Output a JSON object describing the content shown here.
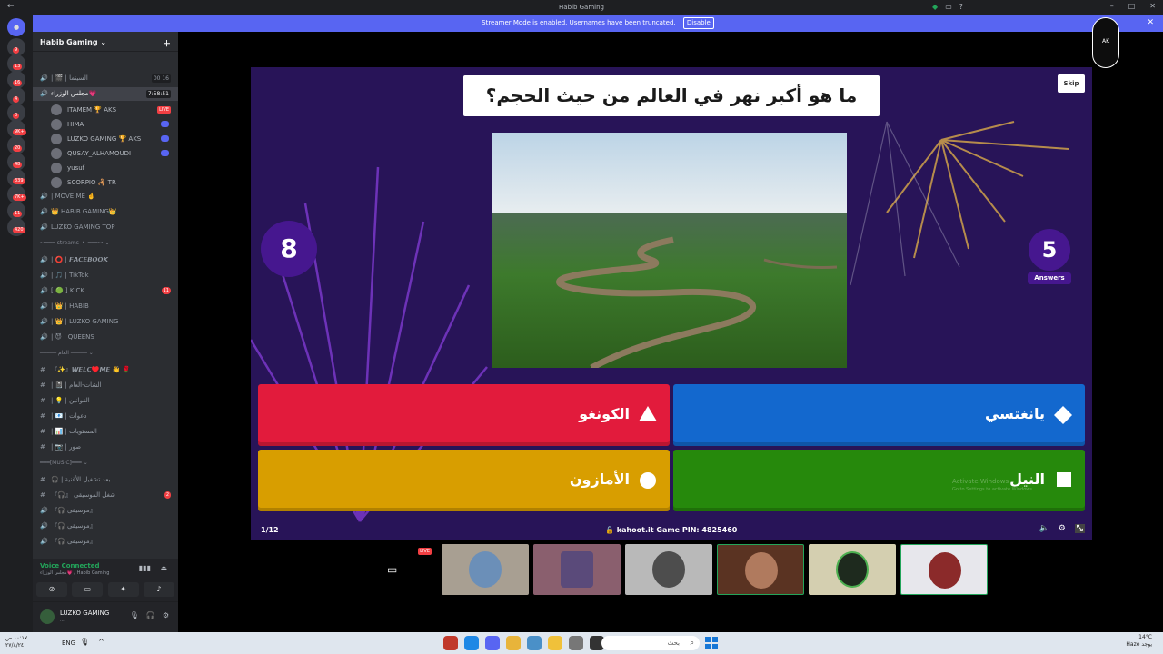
{
  "window": {
    "title": "Habib Gaming"
  },
  "banner": {
    "text": "Streamer Mode is enabled. Usernames have been truncated.",
    "button": "Disable"
  },
  "server": {
    "name": "Habib Gaming ⌄"
  },
  "rail_badges": [
    "9",
    "13",
    "16",
    "4",
    "3",
    "9K+",
    "20",
    "48",
    "339",
    "7K+",
    "11",
    "420"
  ],
  "channels": [
    {
      "icon": "🔊",
      "name": "| 🎬 | السينما",
      "count": "00 16"
    },
    {
      "icon": "🔊",
      "name": "مجلس الوزراء💗",
      "count": "7:58:51",
      "selected": true
    },
    {
      "icon": "🔊",
      "name": "| MOVE ME 🤞"
    },
    {
      "icon": "🔊",
      "name": "👑 HABIB GAMING👑"
    },
    {
      "icon": "🔊",
      "name": "LUZKO GAMING TOP"
    },
    {
      "cat": true,
      "name": "⊶━━━ streams ・ ━━━⊶ ⌄"
    },
    {
      "icon": "🔊",
      "name": "| ⭕ | 𝙁𝘼𝘾𝙀𝘽𝙊𝙊𝙆"
    },
    {
      "icon": "🔊",
      "name": "| 🎵 | TikTok"
    },
    {
      "icon": "🔊",
      "name": "[ 🟢 ] KICK",
      "badge": "11"
    },
    {
      "icon": "🔊",
      "name": "| 👑 | HABIB"
    },
    {
      "icon": "🔊",
      "name": "| 👑 | LUZKO GAMING"
    },
    {
      "icon": "🔊",
      "name": "| 😈 | QUEENS"
    },
    {
      "cat": true,
      "name": "━━━━━ العام ━━━━━ ⌄"
    },
    {
      "icon": "#",
      "name": "『✨』𝙒𝙀𝙇𝘾♥️𝙈𝙀 👋 🌹"
    },
    {
      "icon": "#",
      "name": "| 📓 | الشات-العام"
    },
    {
      "icon": "#",
      "name": "| 💡 | القوانين"
    },
    {
      "icon": "#",
      "name": "| 📧 | دعوات"
    },
    {
      "icon": "#",
      "name": "| 📊 | المستويات"
    },
    {
      "icon": "#",
      "name": "| 📷 | صور"
    },
    {
      "cat": true,
      "name": "━━━[MUSIC]━━━ ⌄"
    },
    {
      "icon": "#",
      "name": "🎧 | بعد تشغيل الأغنية"
    },
    {
      "icon": "#",
      "name": "『🎧』 شغل الموسيقى",
      "badge": "2"
    },
    {
      "icon": "🔊",
      "name": "『🎧 موسيقى』"
    },
    {
      "icon": "🔊",
      "name": "『🎧 موسيقى』"
    },
    {
      "icon": "🔊",
      "name": "『🎧 موسيقى』"
    }
  ],
  "voice_users": [
    {
      "name": "ITAMEM 🏆 AKS",
      "tag": "LIVE"
    },
    {
      "name": "HIMA",
      "tag": "game"
    },
    {
      "name": "LUZKO GAMING 🏆 AKS",
      "tag": "game"
    },
    {
      "name": "QUSAY_ALHAMOUDI",
      "tag": "game"
    },
    {
      "name": "yusuf",
      "tag": ""
    },
    {
      "name": "SCORPIO 🦂 TR",
      "tag": ""
    }
  ],
  "voice": {
    "status": "Voice Connected",
    "sub": "مجلس الوزراء💗 / Habib Gaming"
  },
  "user": {
    "name": "LUZKO GAMING",
    "status": "..."
  },
  "kahoot": {
    "question": "ما هو أكبر نهر في العالم من حيث الحجم؟",
    "skip": "Skip",
    "timer": "8",
    "answers_count": "5",
    "answers_label": "Answers",
    "answers": [
      {
        "text": "الكونغو",
        "color": "#e21b3c",
        "shape": "triangle"
      },
      {
        "text": "يانغتسي",
        "color": "#1368ce",
        "shape": "diamond"
      },
      {
        "text": "الأمازون",
        "color": "#d89e00",
        "shape": "circle"
      },
      {
        "text": "النيل",
        "color": "#26890c",
        "shape": "square"
      }
    ],
    "progress": "1/12",
    "pin": "kahoot.it  Game PIN: 4825460"
  },
  "watermark": {
    "title": "Activate Windows",
    "sub": "Go to Settings to activate Windows."
  },
  "stream_tiles": [
    {
      "live": "LIVE"
    }
  ],
  "taskbar": {
    "time": "١٠:١٧ ص",
    "date": "٢٧/٨/٢٤",
    "lang": "ENG",
    "search": "بحث",
    "temp": "14°C",
    "weather": "Haze يوجد"
  }
}
